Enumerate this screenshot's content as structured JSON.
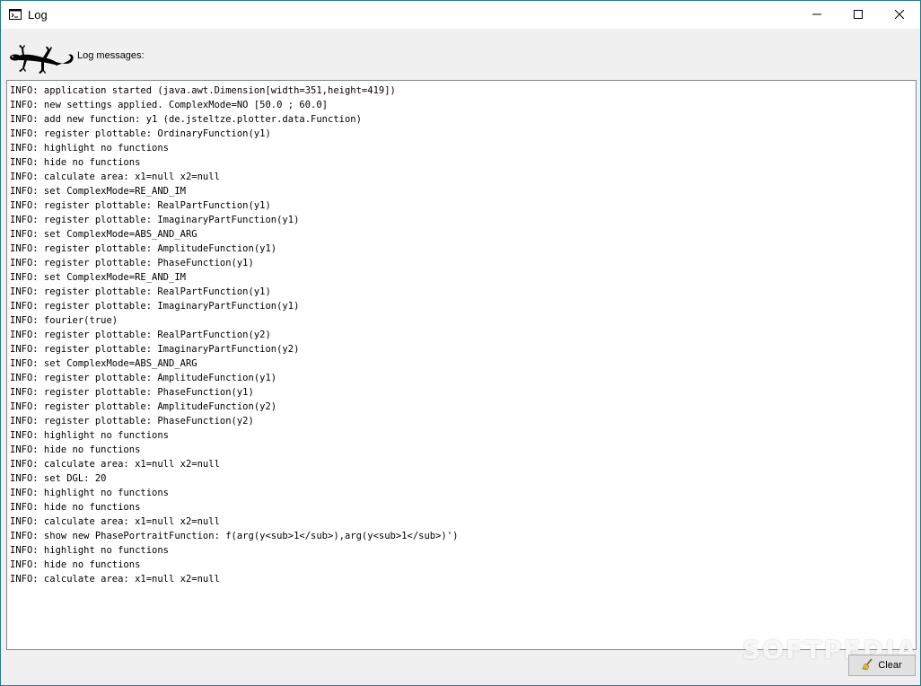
{
  "window": {
    "title": "Log"
  },
  "header": {
    "label": "Log messages:"
  },
  "log": {
    "lines": [
      "INFO: application started (java.awt.Dimension[width=351,height=419])",
      "INFO: new settings applied. ComplexMode=NO [50.0 ; 60.0]",
      "INFO: add new function: y1 (de.jsteltze.plotter.data.Function)",
      "INFO: register plottable: OrdinaryFunction(y1)",
      "INFO: highlight no functions",
      "INFO: hide no functions",
      "INFO: calculate area: x1=null x2=null",
      "INFO: set ComplexMode=RE_AND_IM",
      "INFO: register plottable: RealPartFunction(y1)",
      "INFO: register plottable: ImaginaryPartFunction(y1)",
      "INFO: set ComplexMode=ABS_AND_ARG",
      "INFO: register plottable: AmplitudeFunction(y1)",
      "INFO: register plottable: PhaseFunction(y1)",
      "INFO: set ComplexMode=RE_AND_IM",
      "INFO: register plottable: RealPartFunction(y1)",
      "INFO: register plottable: ImaginaryPartFunction(y1)",
      "INFO: fourier(true)",
      "INFO: register plottable: RealPartFunction(y2)",
      "INFO: register plottable: ImaginaryPartFunction(y2)",
      "INFO: set ComplexMode=ABS_AND_ARG",
      "INFO: register plottable: AmplitudeFunction(y1)",
      "INFO: register plottable: PhaseFunction(y1)",
      "INFO: register plottable: AmplitudeFunction(y2)",
      "INFO: register plottable: PhaseFunction(y2)",
      "INFO: highlight no functions",
      "INFO: hide no functions",
      "INFO: calculate area: x1=null x2=null",
      "INFO: set DGL: 20",
      "INFO: highlight no functions",
      "INFO: hide no functions",
      "INFO: calculate area: x1=null x2=null",
      "INFO: show new PhasePortraitFunction: f(arg(y<sub>1</sub>),arg(y<sub>1</sub>)')",
      "INFO: highlight no functions",
      "INFO: hide no functions",
      "INFO: calculate area: x1=null x2=null"
    ]
  },
  "footer": {
    "clear_label": "Clear"
  },
  "watermark": "SOFTPEDIA",
  "icons": {
    "app": "console-window-icon",
    "logo": "gecko-logo",
    "clear": "broom-icon",
    "minimize": "minimize-icon",
    "maximize": "maximize-icon",
    "close": "close-icon"
  }
}
